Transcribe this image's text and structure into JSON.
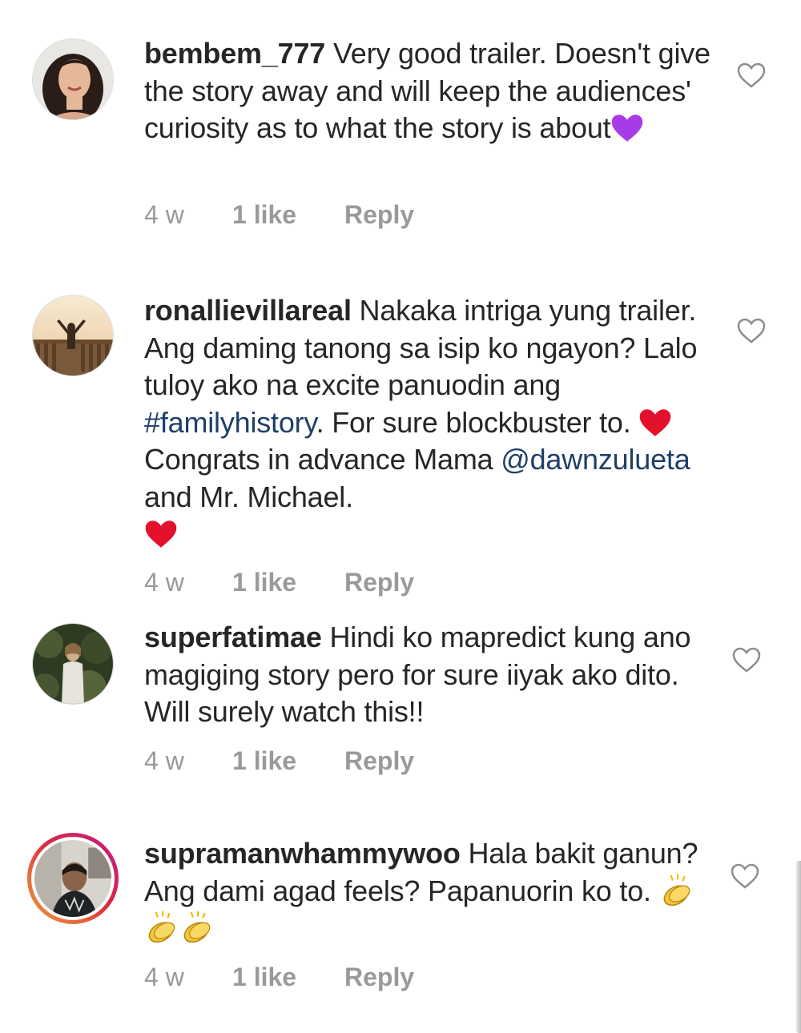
{
  "comments": [
    {
      "username": "bembem_777",
      "text_a": " Very good trailer. Doesn't give the story away and will keep the audiences' curiosity as to what the story is about",
      "emoji_end": "purple-heart",
      "time": "4 w",
      "likes": "1 like",
      "reply": "Reply"
    },
    {
      "username": "ronallievillareal",
      "text_a": " Nakaka intriga yung trailer. Ang daming tanong sa isip ko ngayon? Lalo tuloy ako na excite panuodin ang ",
      "hashtag": "#familyhistory",
      "text_b": ". For sure blockbuster to. ",
      "text_c": " Congrats in advance Mama ",
      "mention": "@dawnzulueta",
      "text_d": "  and Mr. Michael.",
      "emoji": "red-heart",
      "time": "4 w",
      "likes": "1 like",
      "reply": "Reply"
    },
    {
      "username": "superfatimae",
      "text_a": " Hindi ko mapredict kung ano magiging story pero for sure iiyak ako dito. Will surely watch this!!",
      "time": "4 w",
      "likes": "1 like",
      "reply": "Reply"
    },
    {
      "username": "supramanwhammywoo",
      "text_a": " Hala bakit ganun? Ang dami agad feels? Papanuorin ko to. ",
      "emoji": "clapping-hands",
      "time": "4 w",
      "likes": "1 like",
      "reply": "Reply"
    }
  ],
  "colors": {
    "text": "#262626",
    "meta": "#9a9a9a",
    "link": "#1f3f68",
    "heart_icon": "#8e8e8e",
    "red_heart": "#e3112b",
    "purple_heart": "#a93be6"
  },
  "icons": {
    "like": "heart-outline-icon",
    "story_ring": "gradient-ring"
  }
}
